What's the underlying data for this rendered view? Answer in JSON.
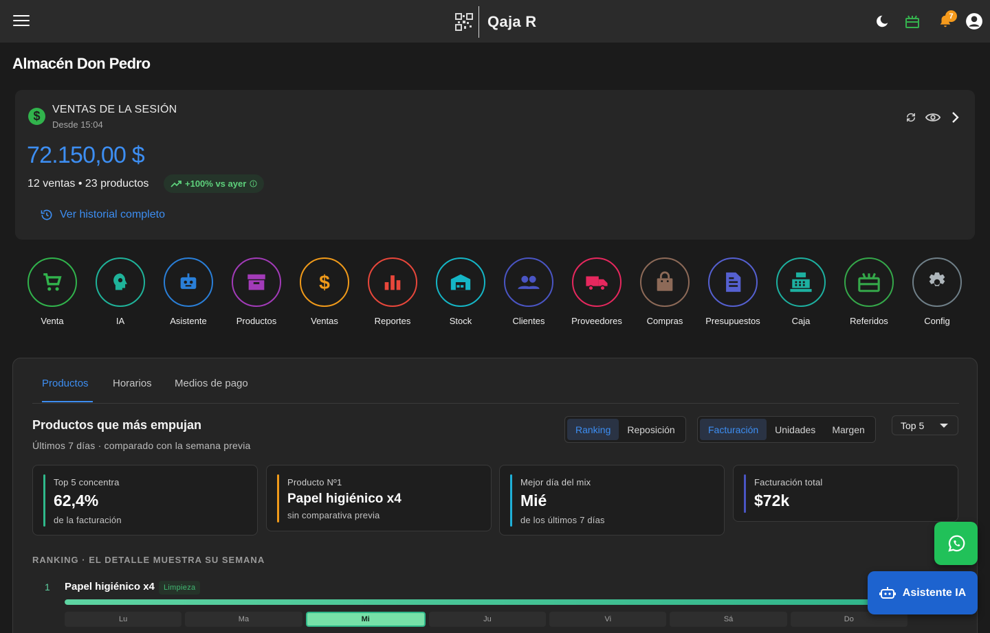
{
  "app": {
    "brand": "Qaja R",
    "notifications_count": "7"
  },
  "store": {
    "name": "Almacén Don Pedro"
  },
  "session": {
    "title": "VENTAS DE LA SESIÓN",
    "since": "Desde 15:04",
    "total": "72.150,00 $",
    "stats": "12 ventas • 23 productos",
    "trend": "+100% vs ayer",
    "history_link": "Ver historial completo"
  },
  "shortcuts": [
    {
      "label": "Venta",
      "icon": "cart-icon",
      "color": "#31b34c"
    },
    {
      "label": "IA",
      "icon": "ai-head-icon",
      "color": "#1fb39a"
    },
    {
      "label": "Asistente",
      "icon": "robot-icon",
      "color": "#2a7fd8"
    },
    {
      "label": "Productos",
      "icon": "archive-box-icon",
      "color": "#a23bb8"
    },
    {
      "label": "Ventas",
      "icon": "dollar-icon",
      "color": "#f09a1a"
    },
    {
      "label": "Reportes",
      "icon": "bar-chart-icon",
      "color": "#e8473b"
    },
    {
      "label": "Stock",
      "icon": "warehouse-icon",
      "color": "#15b6c6"
    },
    {
      "label": "Clientes",
      "icon": "people-icon",
      "color": "#4a55c4"
    },
    {
      "label": "Proveedores",
      "icon": "truck-icon",
      "color": "#e6285e"
    },
    {
      "label": "Compras",
      "icon": "shopping-bag-icon",
      "color": "#8d6a58"
    },
    {
      "label": "Presupuestos",
      "icon": "document-icon",
      "color": "#5560d0"
    },
    {
      "label": "Caja",
      "icon": "cash-register-icon",
      "color": "#1db0a0"
    },
    {
      "label": "Referidos",
      "icon": "gift-icon",
      "color": "#35a84a"
    },
    {
      "label": "Config",
      "icon": "gear-icon",
      "color": "#6f7f88"
    }
  ],
  "analytics": {
    "tabs": [
      "Productos",
      "Horarios",
      "Medios de pago"
    ],
    "title": "Productos que más empujan",
    "subtitle": "Últimos 7 días · comparado con la semana previa",
    "view_toggle": [
      "Ranking",
      "Reposición"
    ],
    "metric_toggle": [
      "Facturación",
      "Unidades",
      "Margen"
    ],
    "top_select": "Top 5",
    "kpis": [
      {
        "label": "Top 5 concentra",
        "value": "62,4%",
        "note": "de la facturación",
        "color": "#2fb88a"
      },
      {
        "label": "Producto Nº1",
        "value": "Papel higiénico x4",
        "note": "sin comparativa previa",
        "color": "#f09a1a"
      },
      {
        "label": "Mejor día del mix",
        "value": "Mié",
        "note": "de los últimos 7 días",
        "color": "#1fb0d8"
      },
      {
        "label": "Facturación total",
        "value": "$72k",
        "note": "",
        "color": "#4a55c4"
      }
    ],
    "ranking_caption": "RANKING · EL DETALLE MUESTRA SU SEMANA",
    "ranking": [
      {
        "rank": "1",
        "name": "Papel higiénico x4",
        "category": "Limpieza",
        "share": 1.0,
        "days": [
          "Lu",
          "Ma",
          "Mi",
          "Ju",
          "Vi",
          "Sá",
          "Do"
        ],
        "best_day": "Mi"
      }
    ]
  },
  "floating": {
    "whatsapp_icon": "whatsapp-icon",
    "ai_assistant": "Asistente IA"
  }
}
